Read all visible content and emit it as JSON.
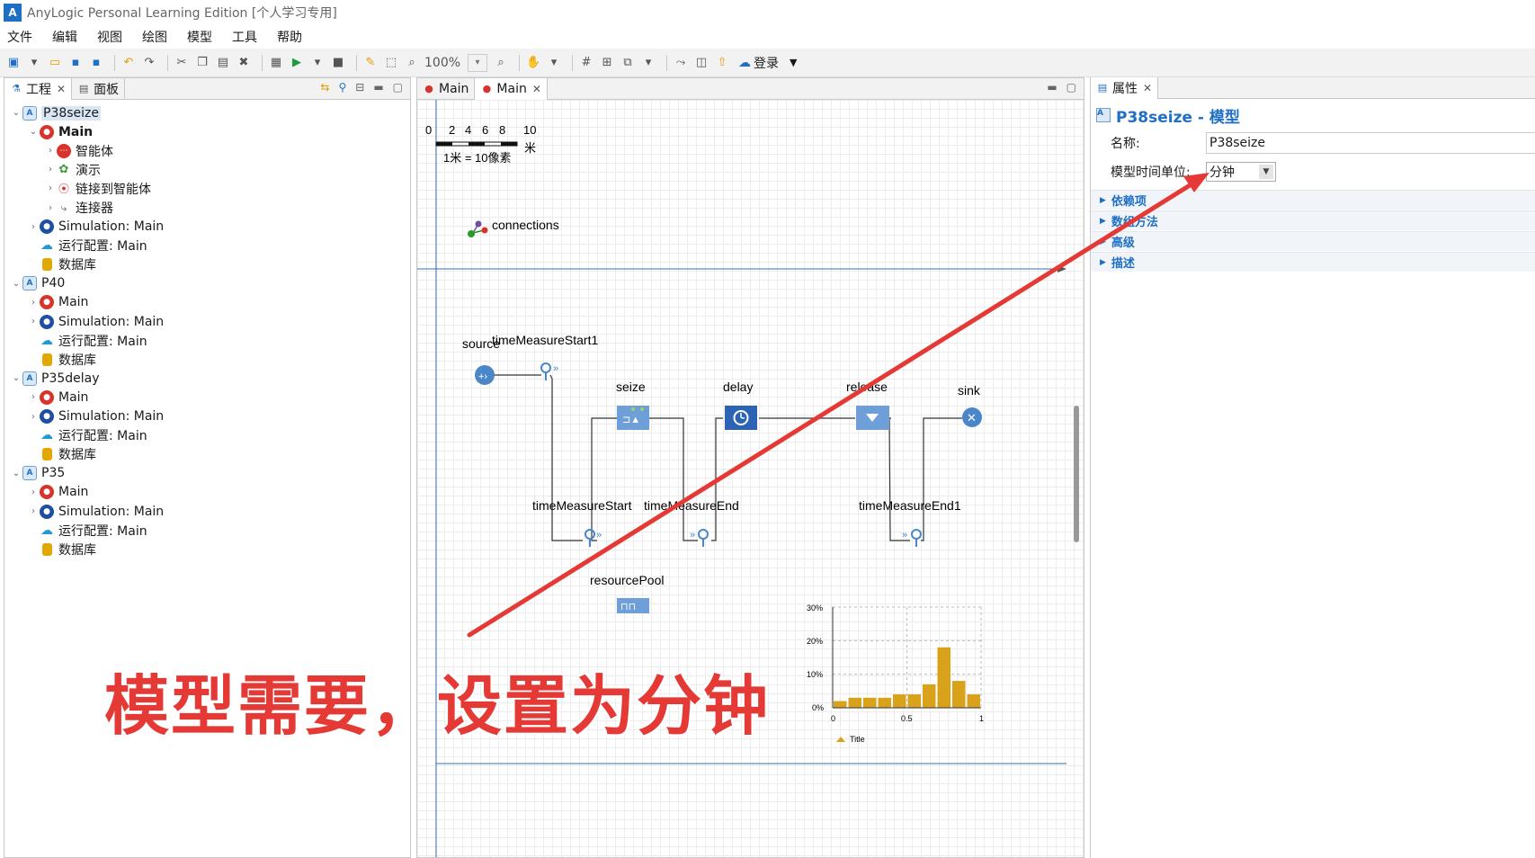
{
  "window": {
    "title": "AnyLogic Personal Learning Edition [个人学习专用]"
  },
  "menu": [
    "文件",
    "编辑",
    "视图",
    "绘图",
    "模型",
    "工具",
    "帮助"
  ],
  "toolbar": {
    "zoom": "100%",
    "login": "登录"
  },
  "left_panel": {
    "tabs": [
      "工程",
      "面板"
    ],
    "tree": [
      {
        "label": "P38seize",
        "icon": "model-icon",
        "depth": 0,
        "arrow": "v",
        "selected": true
      },
      {
        "label": "Main",
        "icon": "agent-icon",
        "depth": 1,
        "arrow": "v",
        "bold": true
      },
      {
        "label": "智能体",
        "icon": "agents-icon",
        "depth": 2,
        "arrow": ">"
      },
      {
        "label": "演示",
        "icon": "presentation-icon",
        "depth": 2,
        "arrow": ">"
      },
      {
        "label": "链接到智能体",
        "icon": "link-icon",
        "depth": 2,
        "arrow": ">"
      },
      {
        "label": "连接器",
        "icon": "connector-icon",
        "depth": 2,
        "arrow": ">"
      },
      {
        "label": "Simulation: Main",
        "icon": "simulation-icon",
        "depth": 1,
        "arrow": ">"
      },
      {
        "label": "运行配置: Main",
        "icon": "cloud-icon",
        "depth": 1,
        "arrow": ""
      },
      {
        "label": "数据库",
        "icon": "database-icon",
        "depth": 1,
        "arrow": ""
      },
      {
        "label": "P40",
        "icon": "model-icon",
        "depth": 0,
        "arrow": "v"
      },
      {
        "label": "Main",
        "icon": "agent-icon",
        "depth": 1,
        "arrow": ">"
      },
      {
        "label": "Simulation: Main",
        "icon": "simulation-icon",
        "depth": 1,
        "arrow": ">"
      },
      {
        "label": "运行配置: Main",
        "icon": "cloud-icon",
        "depth": 1,
        "arrow": ""
      },
      {
        "label": "数据库",
        "icon": "database-icon",
        "depth": 1,
        "arrow": ""
      },
      {
        "label": "P35delay",
        "icon": "model-icon",
        "depth": 0,
        "arrow": "v"
      },
      {
        "label": "Main",
        "icon": "agent-icon",
        "depth": 1,
        "arrow": ">"
      },
      {
        "label": "Simulation: Main",
        "icon": "simulation-icon",
        "depth": 1,
        "arrow": ">"
      },
      {
        "label": "运行配置: Main",
        "icon": "cloud-icon",
        "depth": 1,
        "arrow": ""
      },
      {
        "label": "数据库",
        "icon": "database-icon",
        "depth": 1,
        "arrow": ""
      },
      {
        "label": "P35",
        "icon": "model-icon",
        "depth": 0,
        "arrow": "v"
      },
      {
        "label": "Main",
        "icon": "agent-icon",
        "depth": 1,
        "arrow": ">"
      },
      {
        "label": "Simulation: Main",
        "icon": "simulation-icon",
        "depth": 1,
        "arrow": ">"
      },
      {
        "label": "运行配置: Main",
        "icon": "cloud-icon",
        "depth": 1,
        "arrow": ""
      },
      {
        "label": "数据库",
        "icon": "database-icon",
        "depth": 1,
        "arrow": ""
      }
    ]
  },
  "editor": {
    "tabs": [
      "Main",
      "Main"
    ],
    "scale": {
      "ticks": [
        "0",
        "2",
        "4",
        "6",
        "8",
        "10"
      ],
      "unit": "米",
      "ratio": "1米 = 10像素"
    },
    "connections_label": "connections",
    "blocks": {
      "source": "source",
      "timeMeasureStart1": "timeMeasureStart1",
      "seize": "seize",
      "delay": "delay",
      "release": "release",
      "sink": "sink",
      "timeMeasureStart": "timeMeasureStart",
      "timeMeasureEnd": "timeMeasureEnd",
      "timeMeasureEnd1": "timeMeasureEnd1",
      "resourcePool": "resourcePool"
    },
    "histogram": {
      "legend": "Title",
      "y_ticks": [
        "30%",
        "20%",
        "10%",
        "0%"
      ],
      "x_ticks": [
        "0",
        "0.5",
        "1"
      ]
    }
  },
  "properties": {
    "tab": "属性",
    "title": "P38seize - 模型",
    "name_label": "名称:",
    "name_value": "P38seize",
    "time_unit_label": "模型时间单位:",
    "time_unit_value": "分钟",
    "sections": [
      "依赖项",
      "数组方法",
      "高级",
      "描述"
    ]
  },
  "annotation": {
    "text": "模型需要，设置为分钟"
  },
  "colors": {
    "accent": "#1f6fc5",
    "annotation": "#e53935",
    "bar": "#d9a21b",
    "block": "#4a86c8"
  },
  "chart_data": {
    "type": "bar",
    "title": "",
    "xlabel": "",
    "ylabel": "",
    "xlim": [
      0,
      1
    ],
    "ylim": [
      0,
      0.3
    ],
    "categories": [
      "0.0",
      "0.1",
      "0.2",
      "0.3",
      "0.4",
      "0.5",
      "0.6",
      "0.7",
      "0.8",
      "0.9"
    ],
    "series": [
      {
        "name": "Title",
        "values": [
          0.02,
          0.03,
          0.03,
          0.03,
          0.04,
          0.04,
          0.07,
          0.18,
          0.08,
          0.04
        ]
      }
    ]
  }
}
